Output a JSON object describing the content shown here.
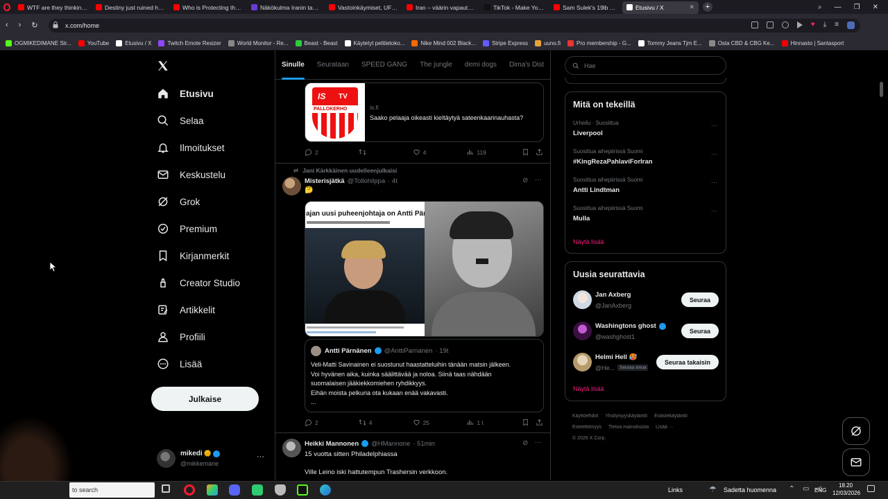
{
  "browser": {
    "tabs": [
      {
        "label": "WTF are they thinking? - Y",
        "color": "#ff0000"
      },
      {
        "label": "Destiny just ruined his ca",
        "color": "#ff0000"
      },
      {
        "label": "Who is Protecting the Jeff",
        "color": "#ff0000"
      },
      {
        "label": "Näkökulma Iranin tapaht",
        "color": "#6a3bd4"
      },
      {
        "label": "Vastoinkäymiset, UFC-une",
        "color": "#ff0000"
      },
      {
        "label": "Iran – väärin vapautettu?",
        "color": "#ff0000"
      },
      {
        "label": "TikTok - Make Your Day",
        "color": "#111111"
      },
      {
        "label": "Sam Sulek's 19lb Post Sho",
        "color": "#ff0000"
      },
      {
        "label": "Etusivu / X",
        "color": "#ffffff"
      }
    ],
    "url": "x.com/home",
    "bookmarks": [
      {
        "label": "OGMIKEDIMANE Str...",
        "color": "#53fc18"
      },
      {
        "label": "YouTube",
        "color": "#ff0000"
      },
      {
        "label": "Etusivu / X",
        "color": "#ffffff"
      },
      {
        "label": "Twitch Emote Resizer",
        "color": "#9146ff"
      },
      {
        "label": "World Monitor - Re...",
        "color": "#888888"
      },
      {
        "label": "Beast - Beast",
        "color": "#2ecc40"
      },
      {
        "label": "Käytetyt pelitietoko...",
        "color": "#ffffff"
      },
      {
        "label": "Nike Mind 002 Black...",
        "color": "#ff6a00"
      },
      {
        "label": "Stripe Express",
        "color": "#635bff"
      },
      {
        "label": "uuno.fi",
        "color": "#e9a23b"
      },
      {
        "label": "Pro membership - G...",
        "color": "#e33"
      },
      {
        "label": "Tommy Jeans Tjm E...",
        "color": "#ffffff"
      },
      {
        "label": "Osta CBD & CBG Ke...",
        "color": "#888888"
      },
      {
        "label": "Hinnasto | Santasport",
        "color": "#e00"
      }
    ]
  },
  "nav": {
    "items": [
      {
        "label": "Etusivu",
        "icon": "home-icon"
      },
      {
        "label": "Selaa",
        "icon": "search-icon"
      },
      {
        "label": "Ilmoitukset",
        "icon": "bell-icon"
      },
      {
        "label": "Keskustelu",
        "icon": "mail-icon"
      },
      {
        "label": "Grok",
        "icon": "grok-icon"
      },
      {
        "label": "Premium",
        "icon": "verified-icon"
      },
      {
        "label": "Kirjanmerkit",
        "icon": "bookmark-icon"
      },
      {
        "label": "Creator Studio",
        "icon": "creator-icon"
      },
      {
        "label": "Artikkelit",
        "icon": "article-icon"
      },
      {
        "label": "Profiili",
        "icon": "profile-icon"
      },
      {
        "label": "Lisää",
        "icon": "more-icon"
      }
    ],
    "post_label": "Julkaise",
    "account": {
      "name": "mikedi",
      "emoji": "🌞",
      "handle": "@mikkemane"
    }
  },
  "timeline": {
    "tabs": [
      "Sinulle",
      "Seurataan",
      "SPEED GANG",
      "The jungle",
      "demi dogs",
      "Dima's Dist"
    ],
    "link_card": {
      "domain": "is.fi",
      "title": "Saako pelaaja oikeasti kieltäytyä sateenkaarinauhasta?",
      "logo_top": "IS",
      "logo_tv": "TV",
      "logo_text": "PALLOKERHO"
    },
    "post1_stats": {
      "replies": "2",
      "reposts": "",
      "likes": "4",
      "views": "119"
    },
    "repost_by": "Jani Kärkkäinen uudelleenjulkaisi",
    "post2": {
      "name": "Misterisjätkä",
      "handle": "@Tollohilppa",
      "time": "· 4t",
      "text": "🤔",
      "image_headline": "ajan uusi puheenjohtaja on Antti Pär",
      "quote": {
        "name": "Antti Pärnänen",
        "handle": "@AnttiParnanen",
        "time": "· 19t",
        "lines": [
          "Veli-Matti Savinainen ei suostunut haastatteluihin tänään matsin jälkeen.",
          "Voi hyvänen aika, kuinka säälittävää ja noloa. Siinä taas nähdään",
          "suomalaisen jääkiekkomiehen ryhdikkyys.",
          "Eihän moista pelkuria ota kukaan enää vakavasti.",
          "..."
        ]
      },
      "stats": {
        "replies": "2",
        "reposts": "4",
        "likes": "25",
        "views": "1 t"
      }
    },
    "post3": {
      "name": "Heikki Mannonen",
      "handle": "@HMannone",
      "time": "· 51min",
      "line1": "15 vuotta sitten Philadelphiassa",
      "line2": "Ville Leino iski hattutempun Trashersin verkkoon."
    }
  },
  "sidebar": {
    "search_placeholder": "Hae",
    "trends_title": "Mitä on tekeillä",
    "trends": [
      {
        "category": "Urheilu · Suosittua",
        "name": "Liverpool"
      },
      {
        "category": "Suosittua aihepiirissä Suomi",
        "name": "#KingRezaPahlaviForIran"
      },
      {
        "category": "Suosittua aihepiirissä Suomi",
        "name": "Antti Lindtman"
      },
      {
        "category": "Suosittua aihepiirissä Suomi",
        "name": "Mulla"
      }
    ],
    "show_more": "Näytä lisää",
    "wtf_title": "Uusia seurattavia",
    "who_to_follow": [
      {
        "name": "Jan Axberg",
        "handle": "@JanAxberg",
        "button": "Seuraa",
        "verified": false
      },
      {
        "name": "Washingtons ghost",
        "handle": "@washghost1",
        "button": "Seuraa",
        "verified": true
      },
      {
        "name": "Helmi Hell 🥵",
        "handle": "@He...",
        "button": "Seuraa takaisin",
        "follows_you": "Seuraa sinua"
      }
    ],
    "footer_links": [
      "Käyttöehdot",
      "Yksityisyyskäytäntö",
      "Evästekäytäntö",
      "Esteettömyys",
      "Tietoa mainoksista",
      "Lisää ···"
    ],
    "copyright": "© 2026 X Corp."
  },
  "taskbar": {
    "search": "to search",
    "links": "Links",
    "weather": "Sadetta huomenna",
    "lang": "ENG",
    "time": "18.20",
    "date": "12/03/2026"
  }
}
